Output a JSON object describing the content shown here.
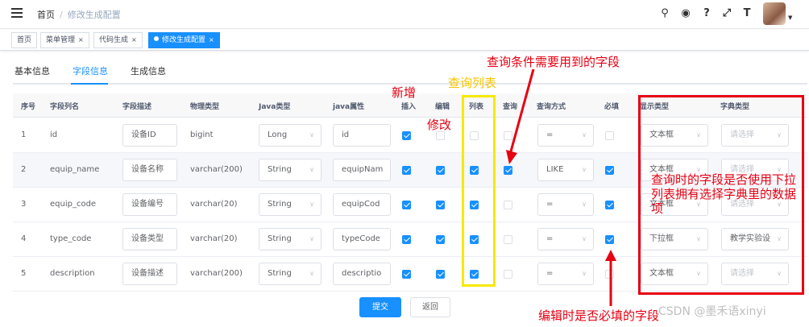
{
  "header": {
    "breadcrumb": [
      "首页",
      "修改生成配置"
    ],
    "tools": [
      "search-icon",
      "github-icon",
      "question-icon",
      "fullscreen-icon",
      "font-size-icon"
    ]
  },
  "tags": [
    {
      "label": "首页",
      "closable": false,
      "active": false
    },
    {
      "label": "菜单管理",
      "closable": true,
      "active": false
    },
    {
      "label": "代码生成",
      "closable": true,
      "active": false
    },
    {
      "label": "修改生成配置",
      "closable": true,
      "active": true
    }
  ],
  "tabs": [
    "基本信息",
    "字段信息",
    "生成信息"
  ],
  "table": {
    "columns": [
      "序号",
      "字段列名",
      "字段描述",
      "物理类型",
      "Java类型",
      "java属性",
      "插入",
      "编辑",
      "列表",
      "查询",
      "查询方式",
      "必填",
      "显示类型",
      "字典类型"
    ],
    "rows": [
      {
        "no": "1",
        "name": "id",
        "desc": "设备ID",
        "phys": "bigint",
        "java": "Long",
        "prop": "id",
        "insert": true,
        "edit": false,
        "list": false,
        "query": false,
        "qmode": "=",
        "required": false,
        "display": "文本框",
        "dict": "请选择"
      },
      {
        "no": "2",
        "name": "equip_name",
        "desc": "设备名称",
        "phys": "varchar(200)",
        "java": "String",
        "prop": "equipNam",
        "insert": true,
        "edit": true,
        "list": true,
        "query": true,
        "qmode": "LIKE",
        "required": true,
        "display": "文本框",
        "dict": "请选择"
      },
      {
        "no": "3",
        "name": "equip_code",
        "desc": "设备编号",
        "phys": "varchar(20)",
        "java": "String",
        "prop": "equipCod",
        "insert": true,
        "edit": true,
        "list": true,
        "query": false,
        "qmode": "=",
        "required": true,
        "display": "文本框",
        "dict": "请选择"
      },
      {
        "no": "4",
        "name": "type_code",
        "desc": "设备类型",
        "phys": "varchar(20)",
        "java": "String",
        "prop": "typeCode",
        "insert": true,
        "edit": true,
        "list": true,
        "query": false,
        "qmode": "=",
        "required": true,
        "display": "下拉框",
        "dict": "教学实验设"
      },
      {
        "no": "5",
        "name": "description",
        "desc": "设备描述",
        "phys": "varchar(200)",
        "java": "String",
        "prop": "descriptio",
        "insert": true,
        "edit": true,
        "list": true,
        "query": false,
        "qmode": "=",
        "required": false,
        "display": "文本框",
        "dict": "请选择"
      }
    ]
  },
  "buttons": {
    "submit": "提交",
    "back": "返回"
  },
  "annotations": {
    "query_fields": "查询条件需要用到的字段",
    "list_query": "查询列表",
    "insert": "新增",
    "edit": "修改",
    "dict_note": "查询时的字段是否使用下拉列表拥有选择字典里的数据项",
    "required_note": "编辑时是否必填的字段"
  },
  "watermark": "CSDN @墨禾语xinyi",
  "colors": {
    "accent": "#1890ff",
    "annotation_red": "#e60012",
    "annotation_yellow": "#f7e900"
  }
}
